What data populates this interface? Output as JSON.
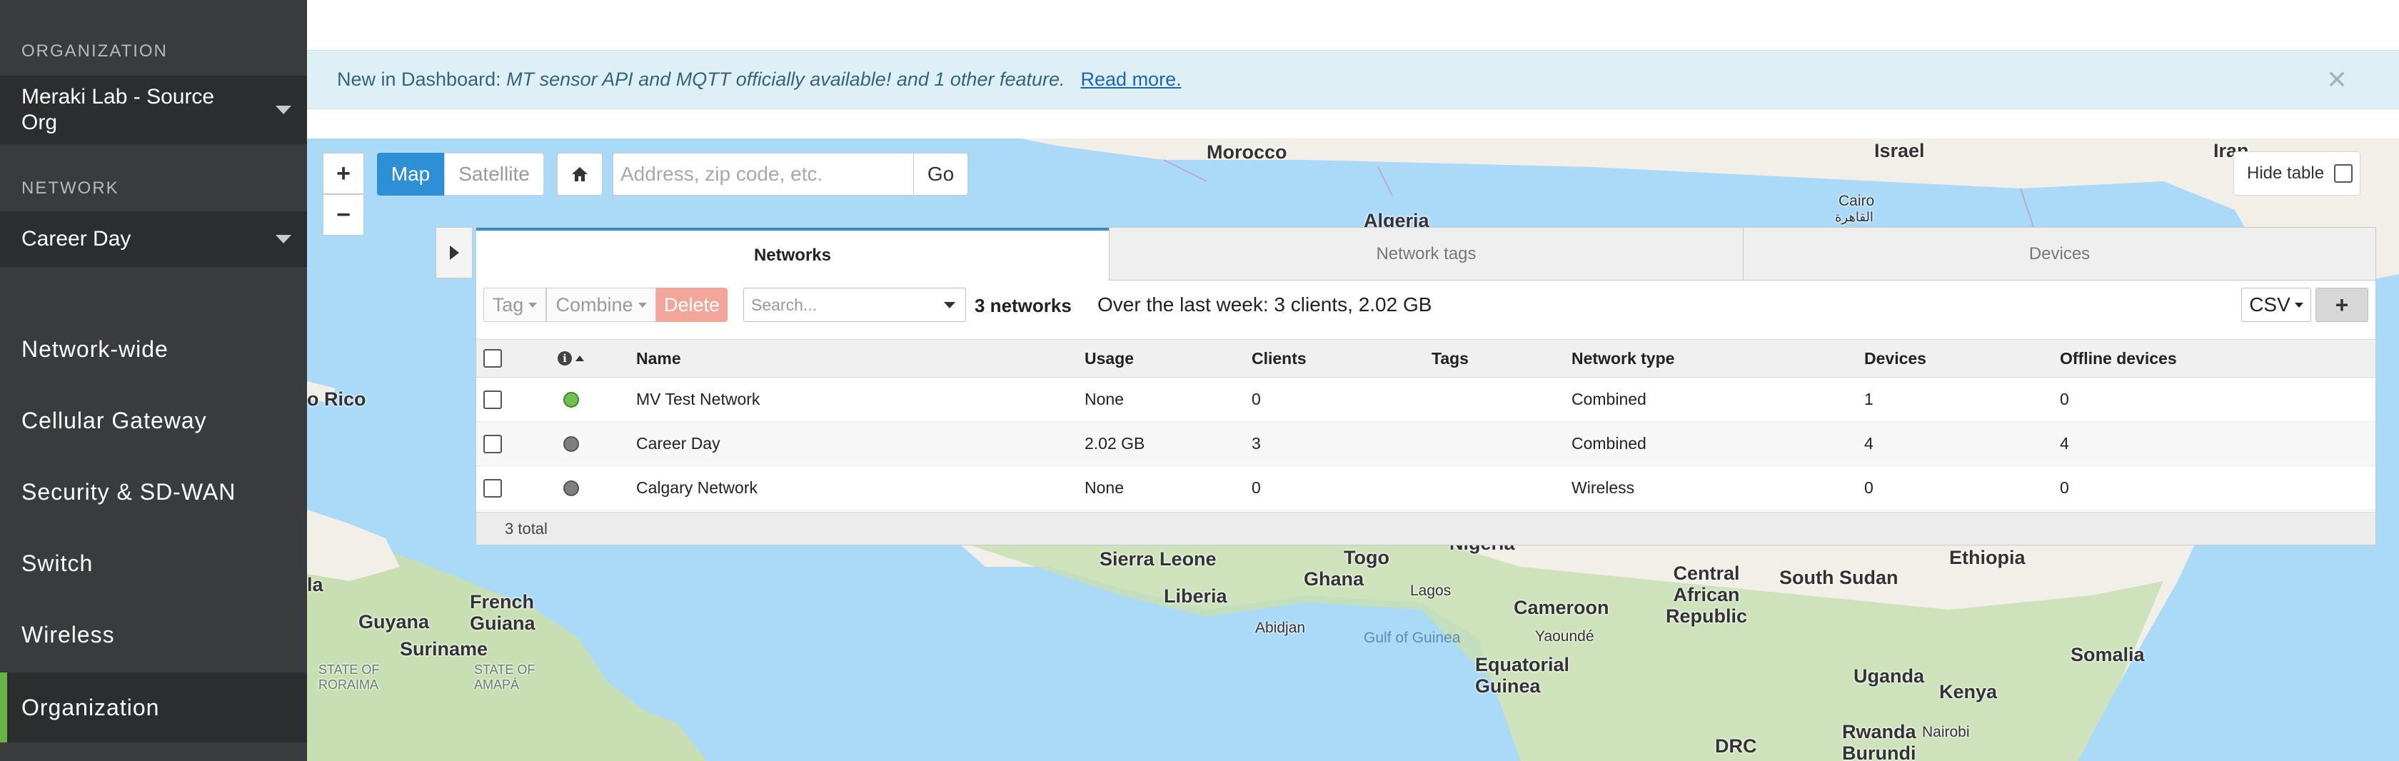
{
  "sidebar": {
    "org_label": "ORGANIZATION",
    "org_select": "Meraki Lab - Source Org",
    "network_label": "NETWORK",
    "network_select": "Career Day",
    "nav": [
      "Network-wide",
      "Cellular Gateway",
      "Security & SD-WAN",
      "Switch",
      "Wireless",
      "Organization"
    ],
    "active_nav": "Organization",
    "accent_color": "#67b346"
  },
  "banner": {
    "prefix": "New in Dashboard:",
    "feature": "MT sensor API and MQTT officially available!",
    "suffix": "and 1 other feature.",
    "link": "Read more.",
    "close_icon": "close-icon"
  },
  "map": {
    "zoom_in": "+",
    "zoom_out": "−",
    "type_map": "Map",
    "type_satellite": "Satellite",
    "address_placeholder": "Address, zip code, etc.",
    "go": "Go",
    "hide_table": "Hide table",
    "places": {
      "morocco": "Morocco",
      "algeria": "Algeria",
      "israel": "Israel",
      "cairo": "Cairo",
      "cairo_ar": "القاهرة",
      "iran": "Iran",
      "puerto_rico": "o Rico",
      "sierra_leone": "Sierra Leone",
      "liberia": "Liberia",
      "ghana": "Ghana",
      "togo": "Togo",
      "nigeria": "Nigeria",
      "lagos": "Lagos",
      "abidjan": "Abidjan",
      "gulf_guinea": "Gulf of Guinea",
      "cameroon": "Cameroon",
      "yaounde": "Yaoundé",
      "eq_guinea": "Equatorial Guinea",
      "car": "Central African Republic",
      "south_sudan": "South Sudan",
      "ethiopia": "Ethiopia",
      "somalia": "Somalia",
      "uganda": "Uganda",
      "kenya": "Kenya",
      "nairobi": "Nairobi",
      "rwanda": "Rwanda",
      "burundi": "Burundi",
      "drc": "DRC",
      "guyana": "Guyana",
      "french_guiana": "French Guiana",
      "suriname": "Suriname",
      "amapa": "STATE OF AMAPÁ",
      "roraima": "STATE OF RORAIMA",
      "la": "la"
    }
  },
  "panel": {
    "tabs": [
      "Networks",
      "Network tags",
      "Devices"
    ],
    "active_tab": "Networks",
    "toolbar": {
      "tag": "Tag",
      "combine": "Combine",
      "delete": "Delete",
      "search_placeholder": "Search...",
      "count": "3 networks",
      "summary": "Over the last week: 3 clients, 2.02 GB",
      "csv": "CSV",
      "add": "+"
    },
    "columns": [
      "Name",
      "Usage",
      "Clients",
      "Tags",
      "Network type",
      "Devices",
      "Offline devices"
    ],
    "rows": [
      {
        "status": "online",
        "name": "MV Test Network",
        "usage": "None",
        "clients": "0",
        "tags": "",
        "type": "Combined",
        "devices": "1",
        "offline": "0"
      },
      {
        "status": "offline",
        "name": "Career Day",
        "usage": "2.02 GB",
        "clients": "3",
        "tags": "",
        "type": "Combined",
        "devices": "4",
        "offline": "4"
      },
      {
        "status": "offline",
        "name": "Calgary Network",
        "usage": "None",
        "clients": "0",
        "tags": "",
        "type": "Wireless",
        "devices": "0",
        "offline": "0"
      }
    ],
    "footer": "3 total"
  },
  "colors": {
    "primary": "#2d8fd5",
    "delete": "#f2a598",
    "status_online": "#6cc24a",
    "status_offline": "#7f7f7f",
    "map_water": "#aadaf7",
    "map_land": "#f2efe9",
    "map_forest": "#c8dfb4"
  }
}
